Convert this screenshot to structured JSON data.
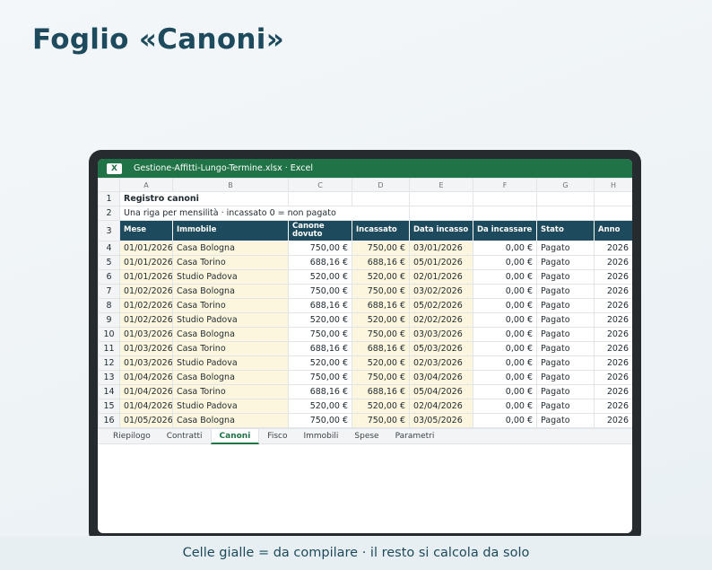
{
  "page_title": "Foglio «Canoni»",
  "window": {
    "badge": "X",
    "title": "Gestione-Affitti-Lungo-Termine.xlsx · Excel"
  },
  "columns": [
    "A",
    "B",
    "C",
    "D",
    "E",
    "F",
    "G",
    "H"
  ],
  "sheet": {
    "title": "Registro canoni",
    "subtitle": "Una riga per mensilità · incassato 0 = non pagato",
    "headers": [
      "Mese",
      "Immobile",
      "Canone dovuto",
      "Incassato",
      "Data incasso",
      "Da incassare",
      "Stato",
      "Anno"
    ],
    "rows": [
      [
        "01/01/2026",
        "Casa Bologna",
        "750,00 €",
        "750,00 €",
        "03/01/2026",
        "0,00 €",
        "Pagato",
        "2026"
      ],
      [
        "01/01/2026",
        "Casa Torino",
        "688,16 €",
        "688,16 €",
        "05/01/2026",
        "0,00 €",
        "Pagato",
        "2026"
      ],
      [
        "01/01/2026",
        "Studio Padova",
        "520,00 €",
        "520,00 €",
        "02/01/2026",
        "0,00 €",
        "Pagato",
        "2026"
      ],
      [
        "01/02/2026",
        "Casa Bologna",
        "750,00 €",
        "750,00 €",
        "03/02/2026",
        "0,00 €",
        "Pagato",
        "2026"
      ],
      [
        "01/02/2026",
        "Casa Torino",
        "688,16 €",
        "688,16 €",
        "05/02/2026",
        "0,00 €",
        "Pagato",
        "2026"
      ],
      [
        "01/02/2026",
        "Studio Padova",
        "520,00 €",
        "520,00 €",
        "02/02/2026",
        "0,00 €",
        "Pagato",
        "2026"
      ],
      [
        "01/03/2026",
        "Casa Bologna",
        "750,00 €",
        "750,00 €",
        "03/03/2026",
        "0,00 €",
        "Pagato",
        "2026"
      ],
      [
        "01/03/2026",
        "Casa Torino",
        "688,16 €",
        "688,16 €",
        "05/03/2026",
        "0,00 €",
        "Pagato",
        "2026"
      ],
      [
        "01/03/2026",
        "Studio Padova",
        "520,00 €",
        "520,00 €",
        "02/03/2026",
        "0,00 €",
        "Pagato",
        "2026"
      ],
      [
        "01/04/2026",
        "Casa Bologna",
        "750,00 €",
        "750,00 €",
        "03/04/2026",
        "0,00 €",
        "Pagato",
        "2026"
      ],
      [
        "01/04/2026",
        "Casa Torino",
        "688,16 €",
        "688,16 €",
        "05/04/2026",
        "0,00 €",
        "Pagato",
        "2026"
      ],
      [
        "01/04/2026",
        "Studio Padova",
        "520,00 €",
        "520,00 €",
        "02/04/2026",
        "0,00 €",
        "Pagato",
        "2026"
      ],
      [
        "01/05/2026",
        "Casa Bologna",
        "750,00 €",
        "750,00 €",
        "03/05/2026",
        "0,00 €",
        "Pagato",
        "2026"
      ]
    ]
  },
  "tabs": [
    {
      "label": "Riepilogo",
      "active": false
    },
    {
      "label": "Contratti",
      "active": false
    },
    {
      "label": "Canoni",
      "active": true
    },
    {
      "label": "Fisco",
      "active": false
    },
    {
      "label": "Immobili",
      "active": false
    },
    {
      "label": "Spese",
      "active": false
    },
    {
      "label": "Parametri",
      "active": false
    }
  ],
  "footer": "Celle gialle = da compilare · il resto si calcola da solo",
  "colors": {
    "title": "#1d4a5c",
    "excel_green": "#207346",
    "header_fill": "#1d4a5c",
    "input_fill": "#fdf6de",
    "frame": "#262b2f"
  },
  "icons": {
    "badge": "excel-icon"
  }
}
